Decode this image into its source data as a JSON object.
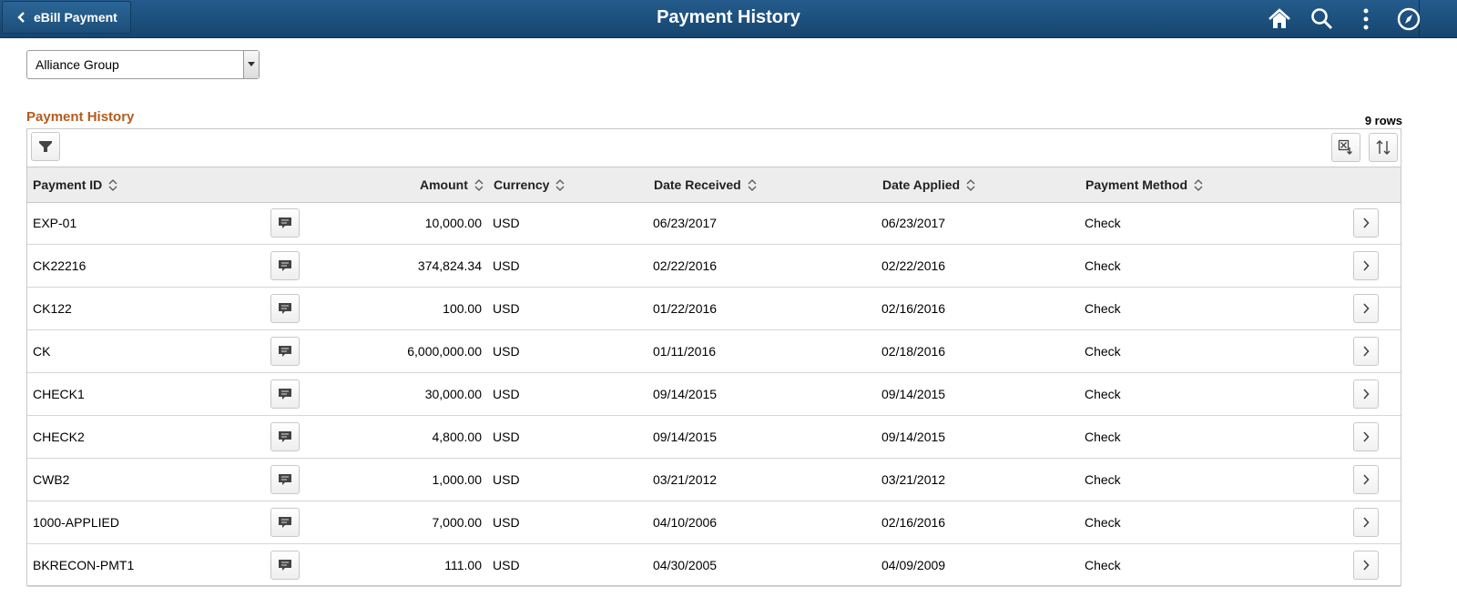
{
  "header": {
    "back_label": "eBill Payment",
    "title": "Payment History",
    "icons": [
      "home-icon",
      "search-icon",
      "actions-menu-icon",
      "navbar-compass-icon"
    ]
  },
  "customer_select": {
    "value": "Alliance Group"
  },
  "grid": {
    "title": "Payment History",
    "row_count": "9 rows",
    "columns": {
      "payment_id": "Payment ID",
      "amount": "Amount",
      "currency": "Currency",
      "date_received": "Date Received",
      "date_applied": "Date Applied",
      "payment_method": "Payment Method"
    },
    "rows": [
      {
        "payment_id": "EXP-01",
        "amount": "10,000.00",
        "currency": "USD",
        "date_received": "06/23/2017",
        "date_applied": "06/23/2017",
        "payment_method": "Check"
      },
      {
        "payment_id": "CK22216",
        "amount": "374,824.34",
        "currency": "USD",
        "date_received": "02/22/2016",
        "date_applied": "02/22/2016",
        "payment_method": "Check"
      },
      {
        "payment_id": "CK122",
        "amount": "100.00",
        "currency": "USD",
        "date_received": "01/22/2016",
        "date_applied": "02/16/2016",
        "payment_method": "Check"
      },
      {
        "payment_id": "CK",
        "amount": "6,000,000.00",
        "currency": "USD",
        "date_received": "01/11/2016",
        "date_applied": "02/18/2016",
        "payment_method": "Check"
      },
      {
        "payment_id": "CHECK1",
        "amount": "30,000.00",
        "currency": "USD",
        "date_received": "09/14/2015",
        "date_applied": "09/14/2015",
        "payment_method": "Check"
      },
      {
        "payment_id": "CHECK2",
        "amount": "4,800.00",
        "currency": "USD",
        "date_received": "09/14/2015",
        "date_applied": "09/14/2015",
        "payment_method": "Check"
      },
      {
        "payment_id": "CWB2",
        "amount": "1,000.00",
        "currency": "USD",
        "date_received": "03/21/2012",
        "date_applied": "03/21/2012",
        "payment_method": "Check"
      },
      {
        "payment_id": "1000-APPLIED",
        "amount": "7,000.00",
        "currency": "USD",
        "date_received": "04/10/2006",
        "date_applied": "02/16/2016",
        "payment_method": "Check"
      },
      {
        "payment_id": "BKRECON-PMT1",
        "amount": "111.00",
        "currency": "USD",
        "date_received": "04/30/2005",
        "date_applied": "04/09/2009",
        "payment_method": "Check"
      }
    ]
  }
}
